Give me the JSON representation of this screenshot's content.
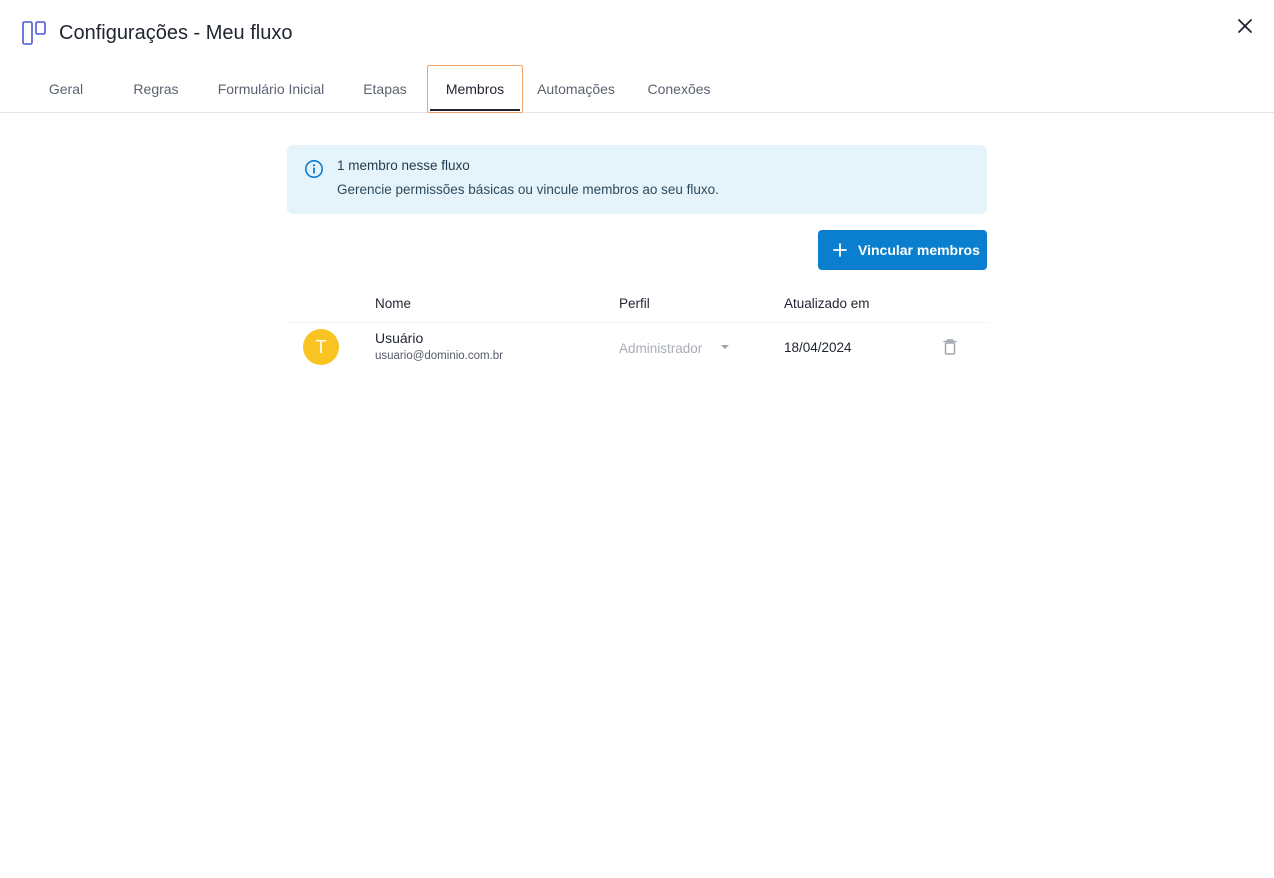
{
  "header": {
    "title": "Configurações - Meu fluxo"
  },
  "tabs": [
    {
      "label": "Geral",
      "active": false
    },
    {
      "label": "Regras",
      "active": false
    },
    {
      "label": "Formulário Inicial",
      "active": false
    },
    {
      "label": "Etapas",
      "active": false
    },
    {
      "label": "Membros",
      "active": true
    },
    {
      "label": "Automações",
      "active": false
    },
    {
      "label": "Conexões",
      "active": false
    }
  ],
  "banner": {
    "title": "1 membro nesse fluxo",
    "text": "Gerencie permissões básicas ou vincule membros ao seu fluxo."
  },
  "add_button": {
    "label": "Vincular membros"
  },
  "table": {
    "columns": [
      "Nome",
      "Perfil",
      "Atualizado em"
    ],
    "rows": [
      {
        "avatar_initial": "T",
        "name": "Usuário",
        "email": "usuario@dominio.com.br",
        "role": "Administrador",
        "updated_at": "18/04/2024"
      }
    ]
  },
  "icons": {
    "app": "board-columns-icon",
    "close": "close-icon",
    "info": "info-icon",
    "plus": "plus-icon",
    "dropdown": "caret-down-icon",
    "delete": "trash-icon"
  },
  "colors": {
    "accent": "#0a7fcf",
    "banner_bg": "#e5f4fa",
    "avatar_bg": "#f9c321",
    "focus_ring": "#f0a36b",
    "app_icon": "#4b57d6"
  }
}
